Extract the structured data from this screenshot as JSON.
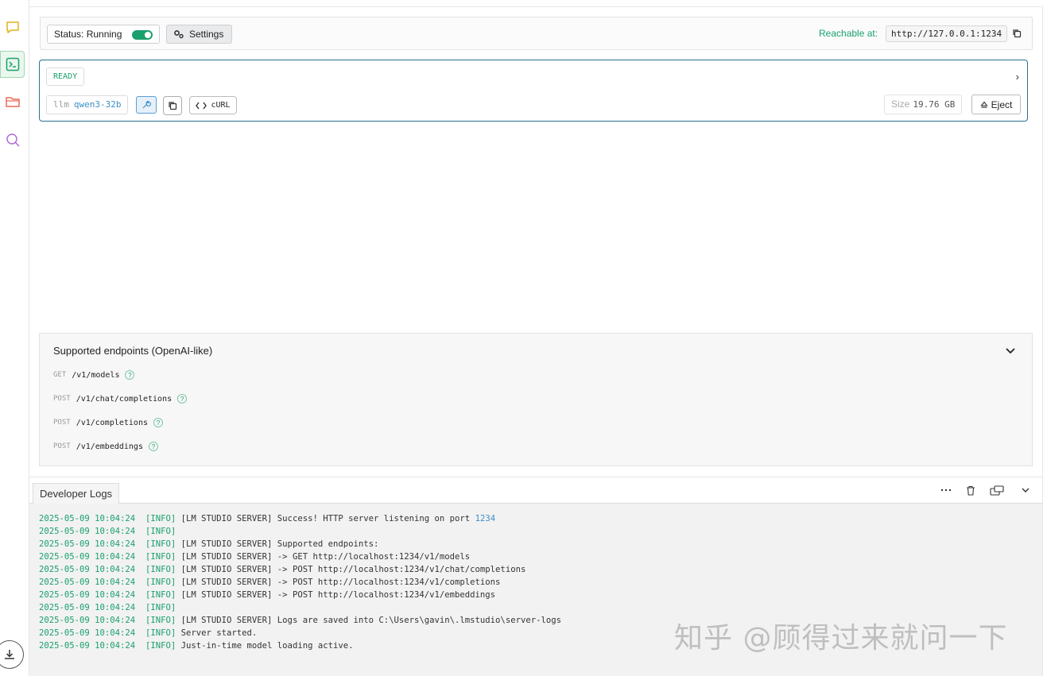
{
  "status": {
    "label": "Status: Running",
    "running": true,
    "settings_label": "Settings",
    "reachable_label": "Reachable at:",
    "reachable_url": "http://127.0.0.1:1234"
  },
  "model": {
    "state": "READY",
    "kind": "llm",
    "name": "qwen3-32b",
    "curl_label": "cURL",
    "size_label": "Size",
    "size_value": "19.76 GB",
    "eject_label": "Eject"
  },
  "endpoints": {
    "title": "Supported endpoints (OpenAI-like)",
    "items": [
      {
        "method": "GET",
        "path": "/v1/models"
      },
      {
        "method": "POST",
        "path": "/v1/chat/completions"
      },
      {
        "method": "POST",
        "path": "/v1/completions"
      },
      {
        "method": "POST",
        "path": "/v1/embeddings"
      }
    ]
  },
  "logs": {
    "tab_label": "Developer Logs",
    "lines": [
      {
        "ts": "2025-05-09 10:04:24",
        "level": "[INFO]",
        "msg": "[LM STUDIO SERVER] Success! HTTP server listening on port ",
        "extra": "1234"
      },
      {
        "ts": "2025-05-09 10:04:24",
        "level": "[INFO]",
        "msg": "",
        "extra": ""
      },
      {
        "ts": "2025-05-09 10:04:24",
        "level": "[INFO]",
        "msg": "[LM STUDIO SERVER] Supported endpoints:",
        "extra": ""
      },
      {
        "ts": "2025-05-09 10:04:24",
        "level": "[INFO]",
        "msg": "[LM STUDIO SERVER] -> GET http://localhost:1234/v1/models",
        "extra": ""
      },
      {
        "ts": "2025-05-09 10:04:24",
        "level": "[INFO]",
        "msg": "[LM STUDIO SERVER] -> POST http://localhost:1234/v1/chat/completions",
        "extra": ""
      },
      {
        "ts": "2025-05-09 10:04:24",
        "level": "[INFO]",
        "msg": "[LM STUDIO SERVER] -> POST http://localhost:1234/v1/completions",
        "extra": ""
      },
      {
        "ts": "2025-05-09 10:04:24",
        "level": "[INFO]",
        "msg": "[LM STUDIO SERVER] -> POST http://localhost:1234/v1/embeddings",
        "extra": ""
      },
      {
        "ts": "2025-05-09 10:04:24",
        "level": "[INFO]",
        "msg": "",
        "extra": ""
      },
      {
        "ts": "2025-05-09 10:04:24",
        "level": "[INFO]",
        "msg": "[LM STUDIO SERVER] Logs are saved into C:\\Users\\gavin\\.lmstudio\\server-logs",
        "extra": ""
      },
      {
        "ts": "2025-05-09 10:04:24",
        "level": "[INFO]",
        "msg": "Server started.",
        "extra": ""
      },
      {
        "ts": "2025-05-09 10:04:24",
        "level": "[INFO]",
        "msg": "Just-in-time model loading active.",
        "extra": ""
      }
    ]
  },
  "watermark": "知乎 @顾得过来就问一下",
  "colors": {
    "accent_green": "#1aa06d",
    "link_blue": "#3a8fc6",
    "card_border": "#2a6f8f"
  }
}
